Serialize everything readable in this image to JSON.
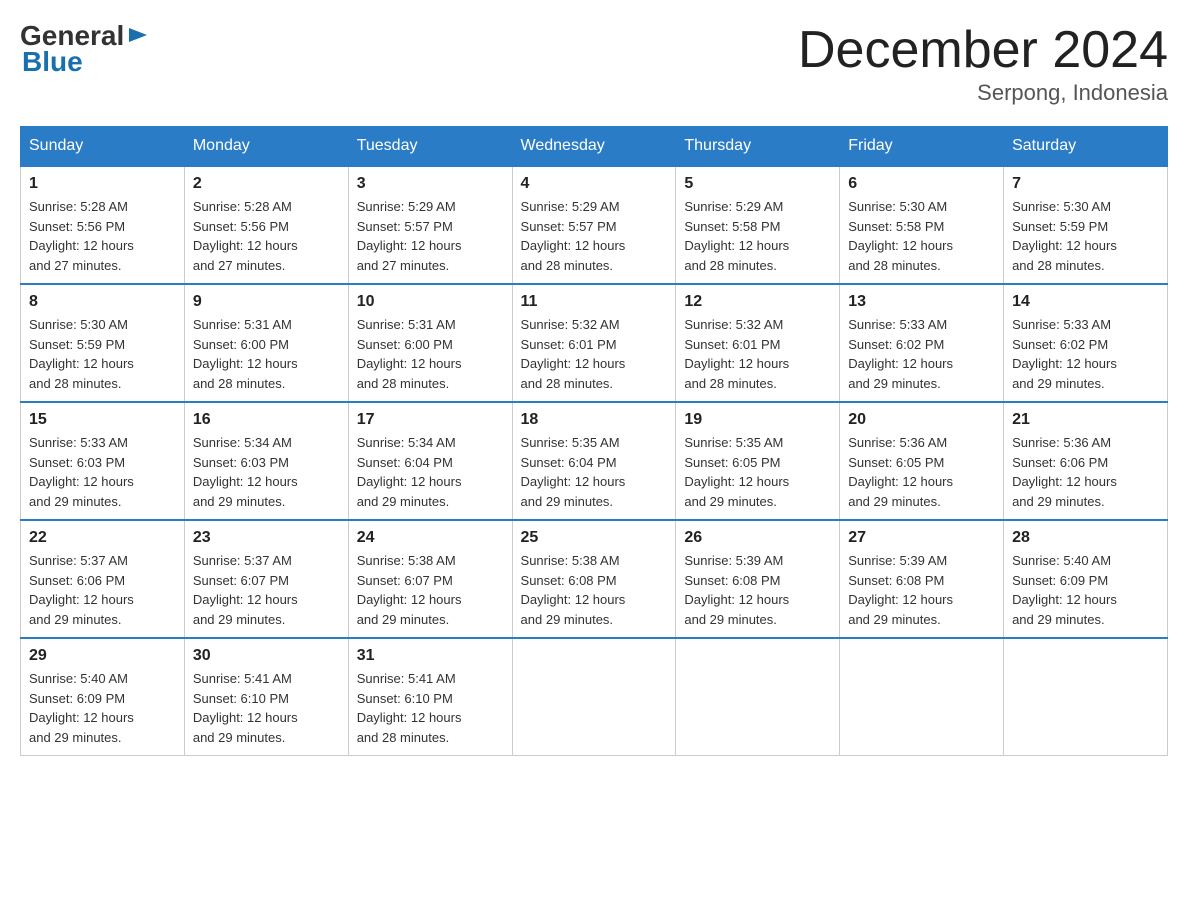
{
  "logo": {
    "general": "General",
    "arrow": "▶",
    "blue": "Blue"
  },
  "title": "December 2024",
  "location": "Serpong, Indonesia",
  "days_of_week": [
    "Sunday",
    "Monday",
    "Tuesday",
    "Wednesday",
    "Thursday",
    "Friday",
    "Saturday"
  ],
  "weeks": [
    [
      {
        "day": "1",
        "sunrise": "5:28 AM",
        "sunset": "5:56 PM",
        "daylight": "12 hours and 27 minutes."
      },
      {
        "day": "2",
        "sunrise": "5:28 AM",
        "sunset": "5:56 PM",
        "daylight": "12 hours and 27 minutes."
      },
      {
        "day": "3",
        "sunrise": "5:29 AM",
        "sunset": "5:57 PM",
        "daylight": "12 hours and 27 minutes."
      },
      {
        "day": "4",
        "sunrise": "5:29 AM",
        "sunset": "5:57 PM",
        "daylight": "12 hours and 28 minutes."
      },
      {
        "day": "5",
        "sunrise": "5:29 AM",
        "sunset": "5:58 PM",
        "daylight": "12 hours and 28 minutes."
      },
      {
        "day": "6",
        "sunrise": "5:30 AM",
        "sunset": "5:58 PM",
        "daylight": "12 hours and 28 minutes."
      },
      {
        "day": "7",
        "sunrise": "5:30 AM",
        "sunset": "5:59 PM",
        "daylight": "12 hours and 28 minutes."
      }
    ],
    [
      {
        "day": "8",
        "sunrise": "5:30 AM",
        "sunset": "5:59 PM",
        "daylight": "12 hours and 28 minutes."
      },
      {
        "day": "9",
        "sunrise": "5:31 AM",
        "sunset": "6:00 PM",
        "daylight": "12 hours and 28 minutes."
      },
      {
        "day": "10",
        "sunrise": "5:31 AM",
        "sunset": "6:00 PM",
        "daylight": "12 hours and 28 minutes."
      },
      {
        "day": "11",
        "sunrise": "5:32 AM",
        "sunset": "6:01 PM",
        "daylight": "12 hours and 28 minutes."
      },
      {
        "day": "12",
        "sunrise": "5:32 AM",
        "sunset": "6:01 PM",
        "daylight": "12 hours and 28 minutes."
      },
      {
        "day": "13",
        "sunrise": "5:33 AM",
        "sunset": "6:02 PM",
        "daylight": "12 hours and 29 minutes."
      },
      {
        "day": "14",
        "sunrise": "5:33 AM",
        "sunset": "6:02 PM",
        "daylight": "12 hours and 29 minutes."
      }
    ],
    [
      {
        "day": "15",
        "sunrise": "5:33 AM",
        "sunset": "6:03 PM",
        "daylight": "12 hours and 29 minutes."
      },
      {
        "day": "16",
        "sunrise": "5:34 AM",
        "sunset": "6:03 PM",
        "daylight": "12 hours and 29 minutes."
      },
      {
        "day": "17",
        "sunrise": "5:34 AM",
        "sunset": "6:04 PM",
        "daylight": "12 hours and 29 minutes."
      },
      {
        "day": "18",
        "sunrise": "5:35 AM",
        "sunset": "6:04 PM",
        "daylight": "12 hours and 29 minutes."
      },
      {
        "day": "19",
        "sunrise": "5:35 AM",
        "sunset": "6:05 PM",
        "daylight": "12 hours and 29 minutes."
      },
      {
        "day": "20",
        "sunrise": "5:36 AM",
        "sunset": "6:05 PM",
        "daylight": "12 hours and 29 minutes."
      },
      {
        "day": "21",
        "sunrise": "5:36 AM",
        "sunset": "6:06 PM",
        "daylight": "12 hours and 29 minutes."
      }
    ],
    [
      {
        "day": "22",
        "sunrise": "5:37 AM",
        "sunset": "6:06 PM",
        "daylight": "12 hours and 29 minutes."
      },
      {
        "day": "23",
        "sunrise": "5:37 AM",
        "sunset": "6:07 PM",
        "daylight": "12 hours and 29 minutes."
      },
      {
        "day": "24",
        "sunrise": "5:38 AM",
        "sunset": "6:07 PM",
        "daylight": "12 hours and 29 minutes."
      },
      {
        "day": "25",
        "sunrise": "5:38 AM",
        "sunset": "6:08 PM",
        "daylight": "12 hours and 29 minutes."
      },
      {
        "day": "26",
        "sunrise": "5:39 AM",
        "sunset": "6:08 PM",
        "daylight": "12 hours and 29 minutes."
      },
      {
        "day": "27",
        "sunrise": "5:39 AM",
        "sunset": "6:08 PM",
        "daylight": "12 hours and 29 minutes."
      },
      {
        "day": "28",
        "sunrise": "5:40 AM",
        "sunset": "6:09 PM",
        "daylight": "12 hours and 29 minutes."
      }
    ],
    [
      {
        "day": "29",
        "sunrise": "5:40 AM",
        "sunset": "6:09 PM",
        "daylight": "12 hours and 29 minutes."
      },
      {
        "day": "30",
        "sunrise": "5:41 AM",
        "sunset": "6:10 PM",
        "daylight": "12 hours and 29 minutes."
      },
      {
        "day": "31",
        "sunrise": "5:41 AM",
        "sunset": "6:10 PM",
        "daylight": "12 hours and 28 minutes."
      },
      null,
      null,
      null,
      null
    ]
  ],
  "labels": {
    "sunrise": "Sunrise:",
    "sunset": "Sunset:",
    "daylight": "Daylight:"
  }
}
